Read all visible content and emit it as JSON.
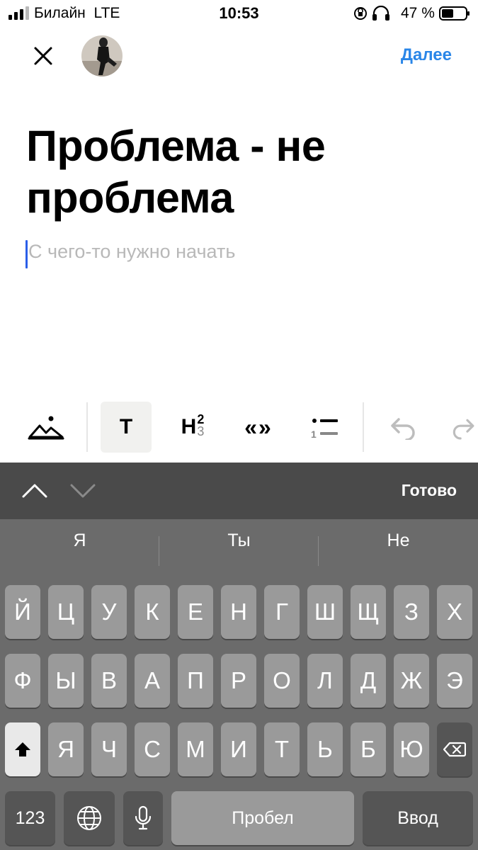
{
  "status_bar": {
    "carrier": "Билайн",
    "network": "LTE",
    "time": "10:53",
    "battery": "47 %"
  },
  "header": {
    "next_label": "Далее"
  },
  "editor": {
    "title": "Проблема - не проблема",
    "placeholder": "С чего-то нужно начать"
  },
  "toolbar": {
    "text_style_label": "T",
    "heading_label": "H",
    "heading_sup": "2",
    "heading_sub": "3",
    "quote_label": "«»",
    "list_label": "1"
  },
  "keyboard": {
    "done_label": "Готово",
    "suggestions": [
      "Я",
      "Ты",
      "Не"
    ],
    "row1": [
      "Й",
      "Ц",
      "У",
      "К",
      "Е",
      "Н",
      "Г",
      "Ш",
      "Щ",
      "З",
      "Х"
    ],
    "row2": [
      "Ф",
      "Ы",
      "В",
      "А",
      "П",
      "Р",
      "О",
      "Л",
      "Д",
      "Ж",
      "Э"
    ],
    "row3": [
      "Я",
      "Ч",
      "С",
      "М",
      "И",
      "Т",
      "Ь",
      "Б",
      "Ю"
    ],
    "numbers_label": "123",
    "space_label": "Пробел",
    "return_label": "Ввод"
  },
  "colors": {
    "accent": "#2a86e8",
    "cursor": "#2a5ee8",
    "keyboard_bg": "#6b6b6b",
    "key_bg": "#9a9a9a"
  }
}
